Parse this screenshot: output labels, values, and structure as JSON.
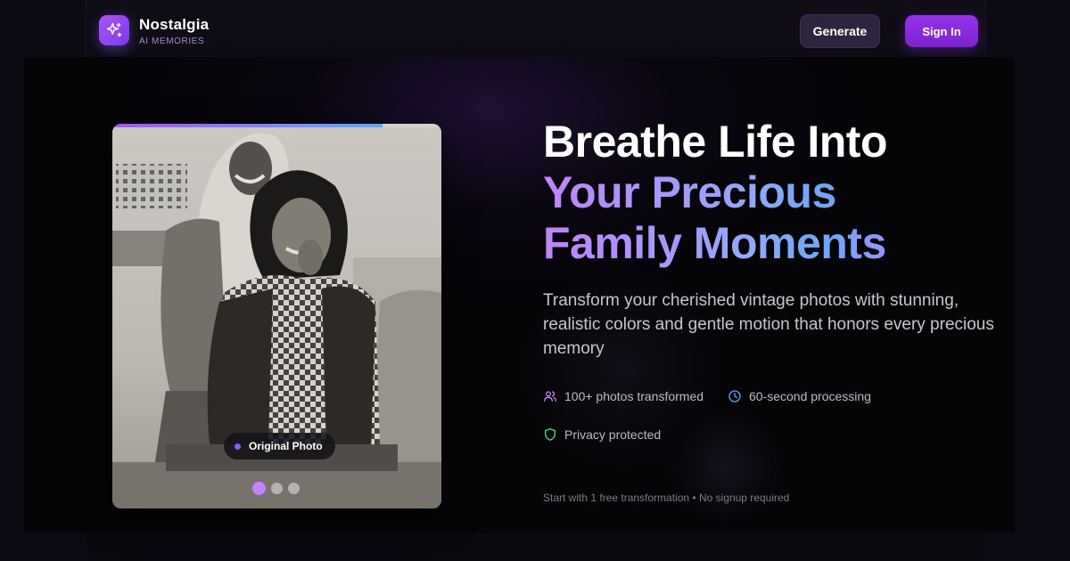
{
  "header": {
    "brand_name": "Nostalgia",
    "brand_subtitle": "AI MEMORIES",
    "generate_label": "Generate",
    "signin_label": "Sign In"
  },
  "photo": {
    "badge_label": "Original Photo",
    "slide_count": 3,
    "active_slide": 1,
    "progress_fraction": 0.82
  },
  "hero": {
    "title_line1": "Breathe Life Into",
    "title_line2": "Your Precious",
    "title_line3": "Family Moments",
    "description": "Transform your cherished vintage photos with stunning, realistic colors and gentle motion that honors every precious memory"
  },
  "features": [
    {
      "icon": "users-icon",
      "label": "100+ photos transformed"
    },
    {
      "icon": "clock-icon",
      "label": "60-second processing"
    },
    {
      "icon": "shield-icon",
      "label": "Privacy protected"
    }
  ],
  "footnote": "Start with 1 free transformation • No signup required",
  "colors": {
    "accent": "#9333ea",
    "accent_light": "#c084fc",
    "blue": "#60a5fa",
    "green": "#4ade80",
    "background": "#050407"
  }
}
